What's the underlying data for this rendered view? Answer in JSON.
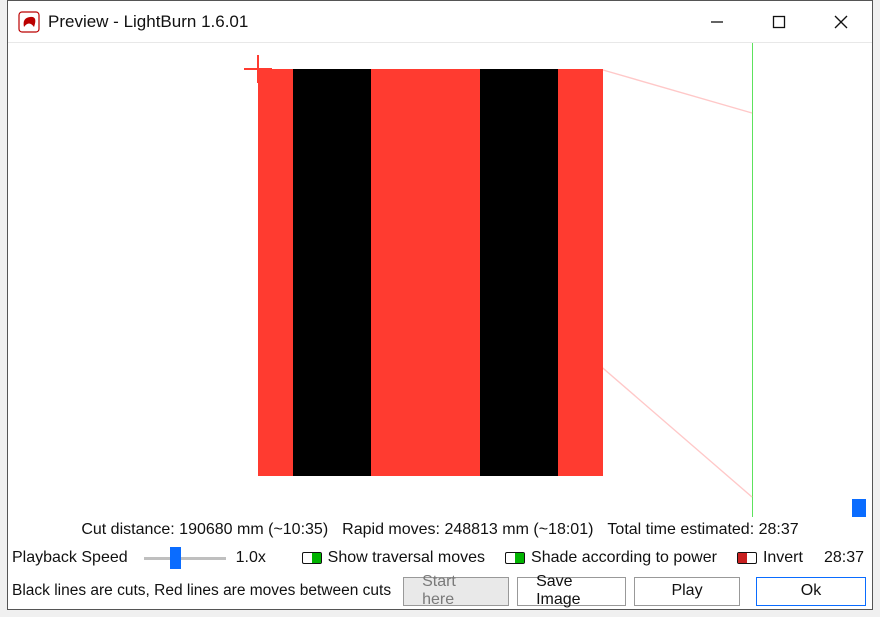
{
  "window": {
    "title": "Preview - LightBurn 1.6.01"
  },
  "stats": {
    "cut_distance_label": "Cut distance:",
    "cut_distance_value": "190680 mm (~10:35)",
    "rapid_moves_label": "Rapid moves:",
    "rapid_moves_value": "248813 mm (~18:01)",
    "total_time_label": "Total time estimated:",
    "total_time_value": "28:37"
  },
  "playback": {
    "label": "Playback Speed",
    "speed": "1.0x",
    "end_time": "28:37"
  },
  "toggles": {
    "show_traversal": {
      "label": "Show traversal moves",
      "on": true
    },
    "shade_power": {
      "label": "Shade according to power",
      "on": true
    },
    "invert": {
      "label": "Invert",
      "on": false
    }
  },
  "hint": "Black lines are cuts, Red lines are moves between cuts",
  "buttons": {
    "start_here": "Start here",
    "save_image": "Save Image",
    "play": "Play",
    "ok": "Ok"
  },
  "colors": {
    "accent": "#0a6cff",
    "cut_red": "#ff3b30"
  }
}
